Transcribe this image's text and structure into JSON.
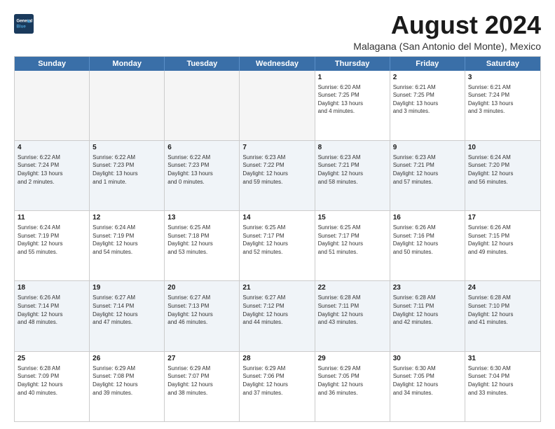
{
  "title": "August 2024",
  "subtitle": "Malagana (San Antonio del Monte), Mexico",
  "logo": {
    "line1": "General",
    "line2": "Blue"
  },
  "days_of_week": [
    "Sunday",
    "Monday",
    "Tuesday",
    "Wednesday",
    "Thursday",
    "Friday",
    "Saturday"
  ],
  "weeks": [
    [
      {
        "day": "",
        "info": ""
      },
      {
        "day": "",
        "info": ""
      },
      {
        "day": "",
        "info": ""
      },
      {
        "day": "",
        "info": ""
      },
      {
        "day": "1",
        "info": "Sunrise: 6:20 AM\nSunset: 7:25 PM\nDaylight: 13 hours\nand 4 minutes."
      },
      {
        "day": "2",
        "info": "Sunrise: 6:21 AM\nSunset: 7:25 PM\nDaylight: 13 hours\nand 3 minutes."
      },
      {
        "day": "3",
        "info": "Sunrise: 6:21 AM\nSunset: 7:24 PM\nDaylight: 13 hours\nand 3 minutes."
      }
    ],
    [
      {
        "day": "4",
        "info": "Sunrise: 6:22 AM\nSunset: 7:24 PM\nDaylight: 13 hours\nand 2 minutes."
      },
      {
        "day": "5",
        "info": "Sunrise: 6:22 AM\nSunset: 7:23 PM\nDaylight: 13 hours\nand 1 minute."
      },
      {
        "day": "6",
        "info": "Sunrise: 6:22 AM\nSunset: 7:23 PM\nDaylight: 13 hours\nand 0 minutes."
      },
      {
        "day": "7",
        "info": "Sunrise: 6:23 AM\nSunset: 7:22 PM\nDaylight: 12 hours\nand 59 minutes."
      },
      {
        "day": "8",
        "info": "Sunrise: 6:23 AM\nSunset: 7:21 PM\nDaylight: 12 hours\nand 58 minutes."
      },
      {
        "day": "9",
        "info": "Sunrise: 6:23 AM\nSunset: 7:21 PM\nDaylight: 12 hours\nand 57 minutes."
      },
      {
        "day": "10",
        "info": "Sunrise: 6:24 AM\nSunset: 7:20 PM\nDaylight: 12 hours\nand 56 minutes."
      }
    ],
    [
      {
        "day": "11",
        "info": "Sunrise: 6:24 AM\nSunset: 7:19 PM\nDaylight: 12 hours\nand 55 minutes."
      },
      {
        "day": "12",
        "info": "Sunrise: 6:24 AM\nSunset: 7:19 PM\nDaylight: 12 hours\nand 54 minutes."
      },
      {
        "day": "13",
        "info": "Sunrise: 6:25 AM\nSunset: 7:18 PM\nDaylight: 12 hours\nand 53 minutes."
      },
      {
        "day": "14",
        "info": "Sunrise: 6:25 AM\nSunset: 7:17 PM\nDaylight: 12 hours\nand 52 minutes."
      },
      {
        "day": "15",
        "info": "Sunrise: 6:25 AM\nSunset: 7:17 PM\nDaylight: 12 hours\nand 51 minutes."
      },
      {
        "day": "16",
        "info": "Sunrise: 6:26 AM\nSunset: 7:16 PM\nDaylight: 12 hours\nand 50 minutes."
      },
      {
        "day": "17",
        "info": "Sunrise: 6:26 AM\nSunset: 7:15 PM\nDaylight: 12 hours\nand 49 minutes."
      }
    ],
    [
      {
        "day": "18",
        "info": "Sunrise: 6:26 AM\nSunset: 7:14 PM\nDaylight: 12 hours\nand 48 minutes."
      },
      {
        "day": "19",
        "info": "Sunrise: 6:27 AM\nSunset: 7:14 PM\nDaylight: 12 hours\nand 47 minutes."
      },
      {
        "day": "20",
        "info": "Sunrise: 6:27 AM\nSunset: 7:13 PM\nDaylight: 12 hours\nand 46 minutes."
      },
      {
        "day": "21",
        "info": "Sunrise: 6:27 AM\nSunset: 7:12 PM\nDaylight: 12 hours\nand 44 minutes."
      },
      {
        "day": "22",
        "info": "Sunrise: 6:28 AM\nSunset: 7:11 PM\nDaylight: 12 hours\nand 43 minutes."
      },
      {
        "day": "23",
        "info": "Sunrise: 6:28 AM\nSunset: 7:11 PM\nDaylight: 12 hours\nand 42 minutes."
      },
      {
        "day": "24",
        "info": "Sunrise: 6:28 AM\nSunset: 7:10 PM\nDaylight: 12 hours\nand 41 minutes."
      }
    ],
    [
      {
        "day": "25",
        "info": "Sunrise: 6:28 AM\nSunset: 7:09 PM\nDaylight: 12 hours\nand 40 minutes."
      },
      {
        "day": "26",
        "info": "Sunrise: 6:29 AM\nSunset: 7:08 PM\nDaylight: 12 hours\nand 39 minutes."
      },
      {
        "day": "27",
        "info": "Sunrise: 6:29 AM\nSunset: 7:07 PM\nDaylight: 12 hours\nand 38 minutes."
      },
      {
        "day": "28",
        "info": "Sunrise: 6:29 AM\nSunset: 7:06 PM\nDaylight: 12 hours\nand 37 minutes."
      },
      {
        "day": "29",
        "info": "Sunrise: 6:29 AM\nSunset: 7:05 PM\nDaylight: 12 hours\nand 36 minutes."
      },
      {
        "day": "30",
        "info": "Sunrise: 6:30 AM\nSunset: 7:05 PM\nDaylight: 12 hours\nand 34 minutes."
      },
      {
        "day": "31",
        "info": "Sunrise: 6:30 AM\nSunset: 7:04 PM\nDaylight: 12 hours\nand 33 minutes."
      }
    ]
  ]
}
